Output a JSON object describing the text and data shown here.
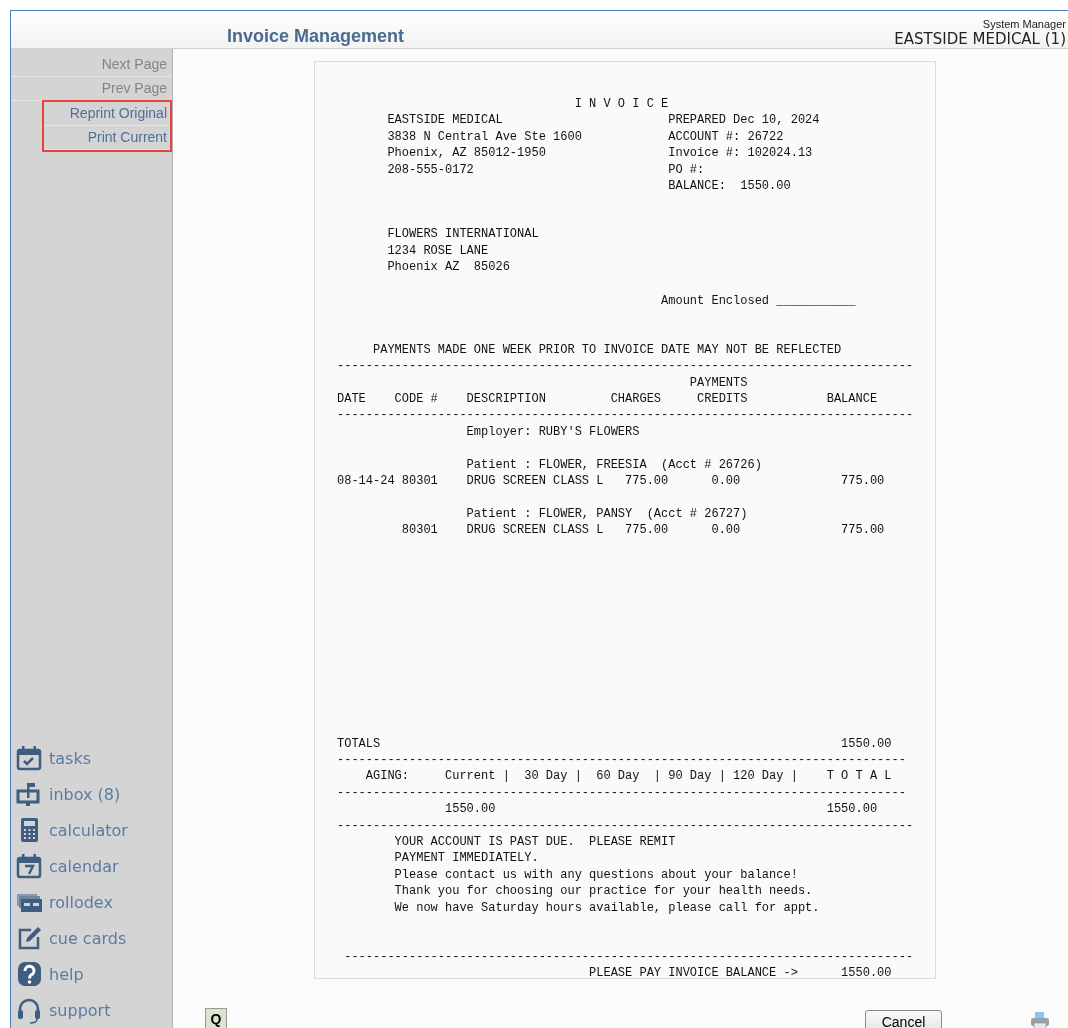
{
  "header": {
    "title": "Invoice Management",
    "user": "System Manager",
    "practice": "EASTSIDE MEDICAL (1)"
  },
  "menu": [
    {
      "label": "Next Page",
      "disabled": true,
      "highlighted": false
    },
    {
      "label": "Prev Page",
      "disabled": true,
      "highlighted": false
    },
    {
      "label": "Reprint Original",
      "disabled": false,
      "highlighted": true
    },
    {
      "label": "Print Current",
      "disabled": false,
      "highlighted": true
    }
  ],
  "tools": [
    {
      "kind": "tasks",
      "label": "tasks"
    },
    {
      "kind": "inbox",
      "label": "inbox (8)"
    },
    {
      "kind": "calculator",
      "label": "calculator"
    },
    {
      "kind": "calendar",
      "label": "calendar"
    },
    {
      "kind": "rollodex",
      "label": "rollodex"
    },
    {
      "kind": "cuecards",
      "label": "cue cards"
    },
    {
      "kind": "help",
      "label": "help"
    },
    {
      "kind": "support",
      "label": "support"
    }
  ],
  "invoice": {
    "sections": [
      {
        "kind": "header",
        "lines": [
          "                                 I N V O I C E",
          "       EASTSIDE MEDICAL                       PREPARED Dec 10, 2024",
          "       3838 N Central Ave Ste 1600            ACCOUNT #: 26722",
          "       Phoenix, AZ 85012-1950                 Invoice #: 102024.13",
          "       208-555-0172                           PO #:",
          "                                              BALANCE:  1550.00"
        ]
      },
      {
        "kind": "address",
        "lines": [
          "       FLOWERS INTERNATIONAL",
          "       1234 ROSE LANE",
          "       Phoenix AZ  85026"
        ]
      },
      {
        "kind": "remit",
        "lines": [
          "                                             Amount Enclosed ___________"
        ]
      },
      {
        "kind": "ledger",
        "lines": [
          "     PAYMENTS MADE ONE WEEK PRIOR TO INVOICE DATE MAY NOT BE REFLECTED",
          "--------------------------------------------------------------------------------",
          "                                                 PAYMENTS",
          "DATE    CODE #    DESCRIPTION         CHARGES     CREDITS           BALANCE",
          "--------------------------------------------------------------------------------",
          "                  Employer: RUBY'S FLOWERS"
        ]
      },
      {
        "kind": "entry",
        "lines": [
          "                  Patient : FLOWER, FREESIA  (Acct # 26726)",
          "08-14-24 80301    DRUG SCREEN CLASS L   775.00      0.00              775.00"
        ]
      },
      {
        "kind": "entry",
        "lines": [
          "                  Patient : FLOWER, PANSY  (Acct # 26727)",
          "         80301    DRUG SCREEN CLASS L   775.00      0.00              775.00"
        ]
      },
      {
        "kind": "totals",
        "lines": [
          "TOTALS                                                                1550.00",
          "-------------------------------------------------------------------------------",
          "    AGING:     Current |  30 Day |  60 Day  | 90 Day | 120 Day |    T O T A L",
          "-------------------------------------------------------------------------------",
          "               1550.00                                              1550.00",
          "--------------------------------------------------------------------------------",
          "        YOUR ACCOUNT IS PAST DUE.  PLEASE REMIT",
          "        PAYMENT IMMEDIATELY.",
          "        Please contact us with any questions about your balance!",
          "        Thank you for choosing our practice for your health needs.",
          "        We now have Saturday hours available, please call for appt."
        ]
      },
      {
        "kind": "footer",
        "lines": [
          " -------------------------------------------------------------------------------",
          "                                   PLEASE PAY INVOICE BALANCE ->      1550.00"
        ]
      }
    ]
  },
  "footer": {
    "query_button": "Q",
    "cancel_button": "Cancel"
  }
}
